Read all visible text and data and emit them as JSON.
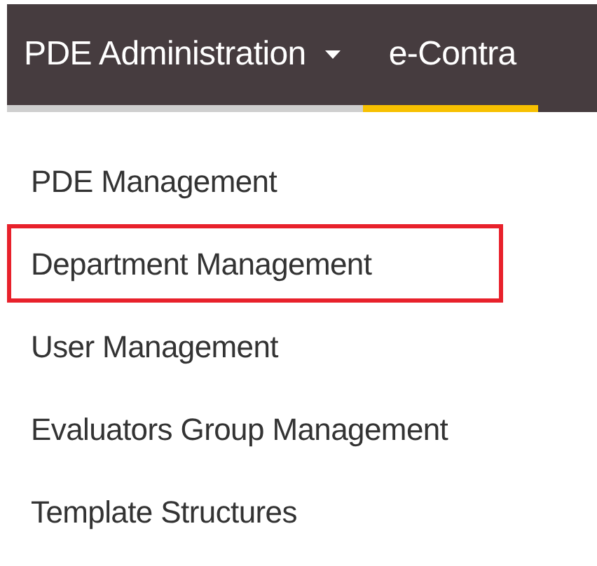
{
  "navbar": {
    "items": [
      {
        "label": "PDE Administration",
        "dropdown": true,
        "selected": false
      },
      {
        "label": "e-Contra",
        "dropdown": false,
        "selected": true
      }
    ]
  },
  "dropdown_menu": {
    "items": [
      {
        "label": "PDE Management",
        "highlighted": false
      },
      {
        "label": "Department Management",
        "highlighted": true
      },
      {
        "label": "User Management",
        "highlighted": false
      },
      {
        "label": "Evaluators Group Management",
        "highlighted": false
      },
      {
        "label": "Template Structures",
        "highlighted": false
      }
    ]
  }
}
